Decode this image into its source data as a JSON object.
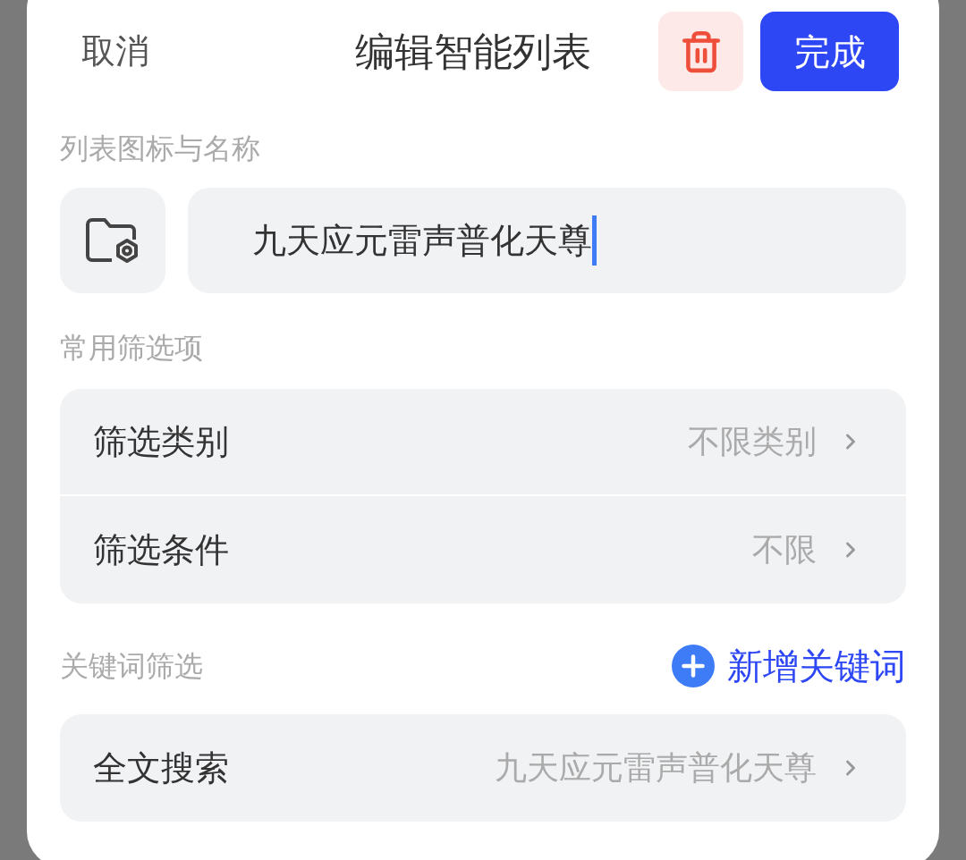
{
  "header": {
    "cancel": "取消",
    "title": "编辑智能列表",
    "done": "完成"
  },
  "icon_name_section": {
    "label": "列表图标与名称",
    "name_value": "九天应元雷声普化天尊"
  },
  "common_filters": {
    "label": "常用筛选项",
    "rows": [
      {
        "label": "筛选类别",
        "value": "不限类别"
      },
      {
        "label": "筛选条件",
        "value": "不限"
      }
    ]
  },
  "keyword_filters": {
    "label": "关键词筛选",
    "add_button": "新增关键词",
    "rows": [
      {
        "label": "全文搜索",
        "value": "九天应元雷声普化天尊"
      }
    ]
  }
}
